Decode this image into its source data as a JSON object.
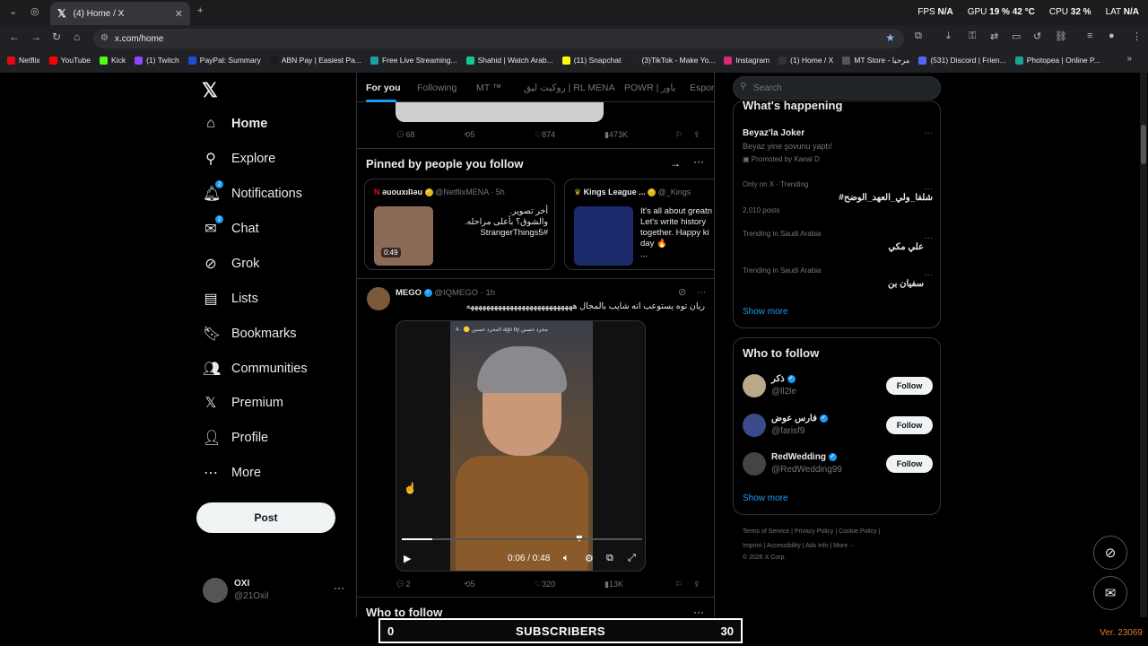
{
  "browser": {
    "tab_title": "(4) Home / X",
    "url": "x.com/home",
    "perf": {
      "fps_label": "FPS",
      "fps": "N/A",
      "gpu_label": "GPU",
      "gpu": "19 % 42 °C",
      "cpu_label": "CPU",
      "cpu": "32 %",
      "lat_label": "LAT",
      "lat": "N/A"
    },
    "bookmarks": [
      "Netflix",
      "YouTube",
      "Kick",
      "(1) Twitch",
      "PayPal: Summary",
      "ABN Pay | Easiest Pa...",
      "Free Live Streaming...",
      "Shahid | Watch Arab...",
      "(11) Snapchat",
      "(3)TikTok - Make Yo...",
      "Instagram",
      "(1) Home / X",
      "MT Store - مرحبا",
      "(531) Discord | Frien...",
      "Photopea | Online P..."
    ],
    "bookmark_colors": [
      "#e50914",
      "#ff0000",
      "#53fc18",
      "#9146ff",
      "#1d4ed8",
      "#1a1a1a",
      "#21a0a0",
      "#18c88c",
      "#fffc00",
      "#222222",
      "#d62976",
      "#333333",
      "#555555",
      "#5865f2",
      "#18a497"
    ]
  },
  "nav": {
    "items": [
      {
        "label": "Home",
        "icon": "home-icon",
        "glyph": "⌂"
      },
      {
        "label": "Explore",
        "icon": "search-icon",
        "glyph": "⚲"
      },
      {
        "label": "Notifications",
        "icon": "bell-icon",
        "glyph": "🔔︎",
        "badge": "2"
      },
      {
        "label": "Chat",
        "icon": "mail-icon",
        "glyph": "✉",
        "badge": "2"
      },
      {
        "label": "Grok",
        "icon": "grok-icon",
        "glyph": "⊘"
      },
      {
        "label": "Lists",
        "icon": "list-icon",
        "glyph": "▤"
      },
      {
        "label": "Bookmarks",
        "icon": "bookmark-icon",
        "glyph": "🔖︎"
      },
      {
        "label": "Communities",
        "icon": "communities-icon",
        "glyph": "👥︎"
      },
      {
        "label": "Premium",
        "icon": "x-icon",
        "glyph": "𝕏"
      },
      {
        "label": "Profile",
        "icon": "profile-icon",
        "glyph": "👤︎"
      },
      {
        "label": "More",
        "icon": "more-icon",
        "glyph": "⋯"
      }
    ],
    "post_label": "Post",
    "account_name": "OXI",
    "account_handle": "@21Oxil"
  },
  "timeline": {
    "tabs": [
      "For you",
      "Following",
      "MT ™",
      "روكيت ليق | RL MENA",
      "POWR | باور",
      "Espor"
    ],
    "prev_actions": {
      "replies": "68",
      "reposts": "5",
      "likes": "874",
      "views": "473K"
    },
    "pinned_title": "Pinned by people you follow",
    "pinned": [
      {
        "name": "ǝuouxılʇǝu",
        "handle": "@NetflixMENA",
        "time": "· 5h",
        "duration": "0:49",
        "text1": "أخر تصوير.",
        "text2": "والشوق؟ بأعلى مراحله.",
        "text3": "#StrangerThings5"
      },
      {
        "name": "Kings League ...",
        "handle": "@_Kings",
        "text1": "It's all about greatn",
        "text2": "Let's write history",
        "text3": "together. Happy ki",
        "text4": "day 🔥",
        "text5": "..."
      }
    ],
    "tweet": {
      "name": "MEGO",
      "handle": "@IQMEGO",
      "time": "· 1h",
      "text": "ريان توه يستوعب انه شايب بالمجال هههههههههههههههههههههههههههه",
      "video_time": "0:06 / 0:48",
      "progress": 0.125,
      "video_top": "مجرد حسين 🟡 · 4h ago by مجرد حسين",
      "actions": {
        "replies": "2",
        "reposts": "5",
        "likes": "320",
        "views": "13K"
      }
    },
    "wtf_title": "Who to follow"
  },
  "sidebar": {
    "search_placeholder": "Search",
    "happening_title": "What's happening",
    "trends": [
      {
        "context": "",
        "name": "Beyaz'la Joker",
        "sub": "Beyaz yine şovunu yaptı!",
        "promo": "Promoted by Kanal D"
      },
      {
        "context": "Only on X · Trending",
        "name": "#شلفا_ولي_العهد_الوضح",
        "sub": "2,010 posts"
      },
      {
        "context": "Trending in Saudi Arabia",
        "name": "علي مكي"
      },
      {
        "context": "Trending in Saudi Arabia",
        "name": "سفيان بن"
      }
    ],
    "show_more": "Show more",
    "wtf_title": "Who to follow",
    "wtf": [
      {
        "name": "ذكر",
        "handle": "@ll2le",
        "button": "Follow"
      },
      {
        "name": "فارس عوض",
        "handle": "@farisf9",
        "button": "Follow"
      },
      {
        "name": "RedWedding",
        "handle": "@RedWedding99",
        "button": "Follow"
      }
    ],
    "footer1": "Terms of Service  |  Privacy Policy  |  Cookie Policy  |",
    "footer2": "Imprint  |  Accessibility  |  Ads info  |  More ···",
    "footer3": "© 2026 X Corp."
  },
  "overlay": {
    "current": "0",
    "label": "SUBSCRIBERS",
    "goal": "30",
    "version": "Ver. 23069"
  }
}
